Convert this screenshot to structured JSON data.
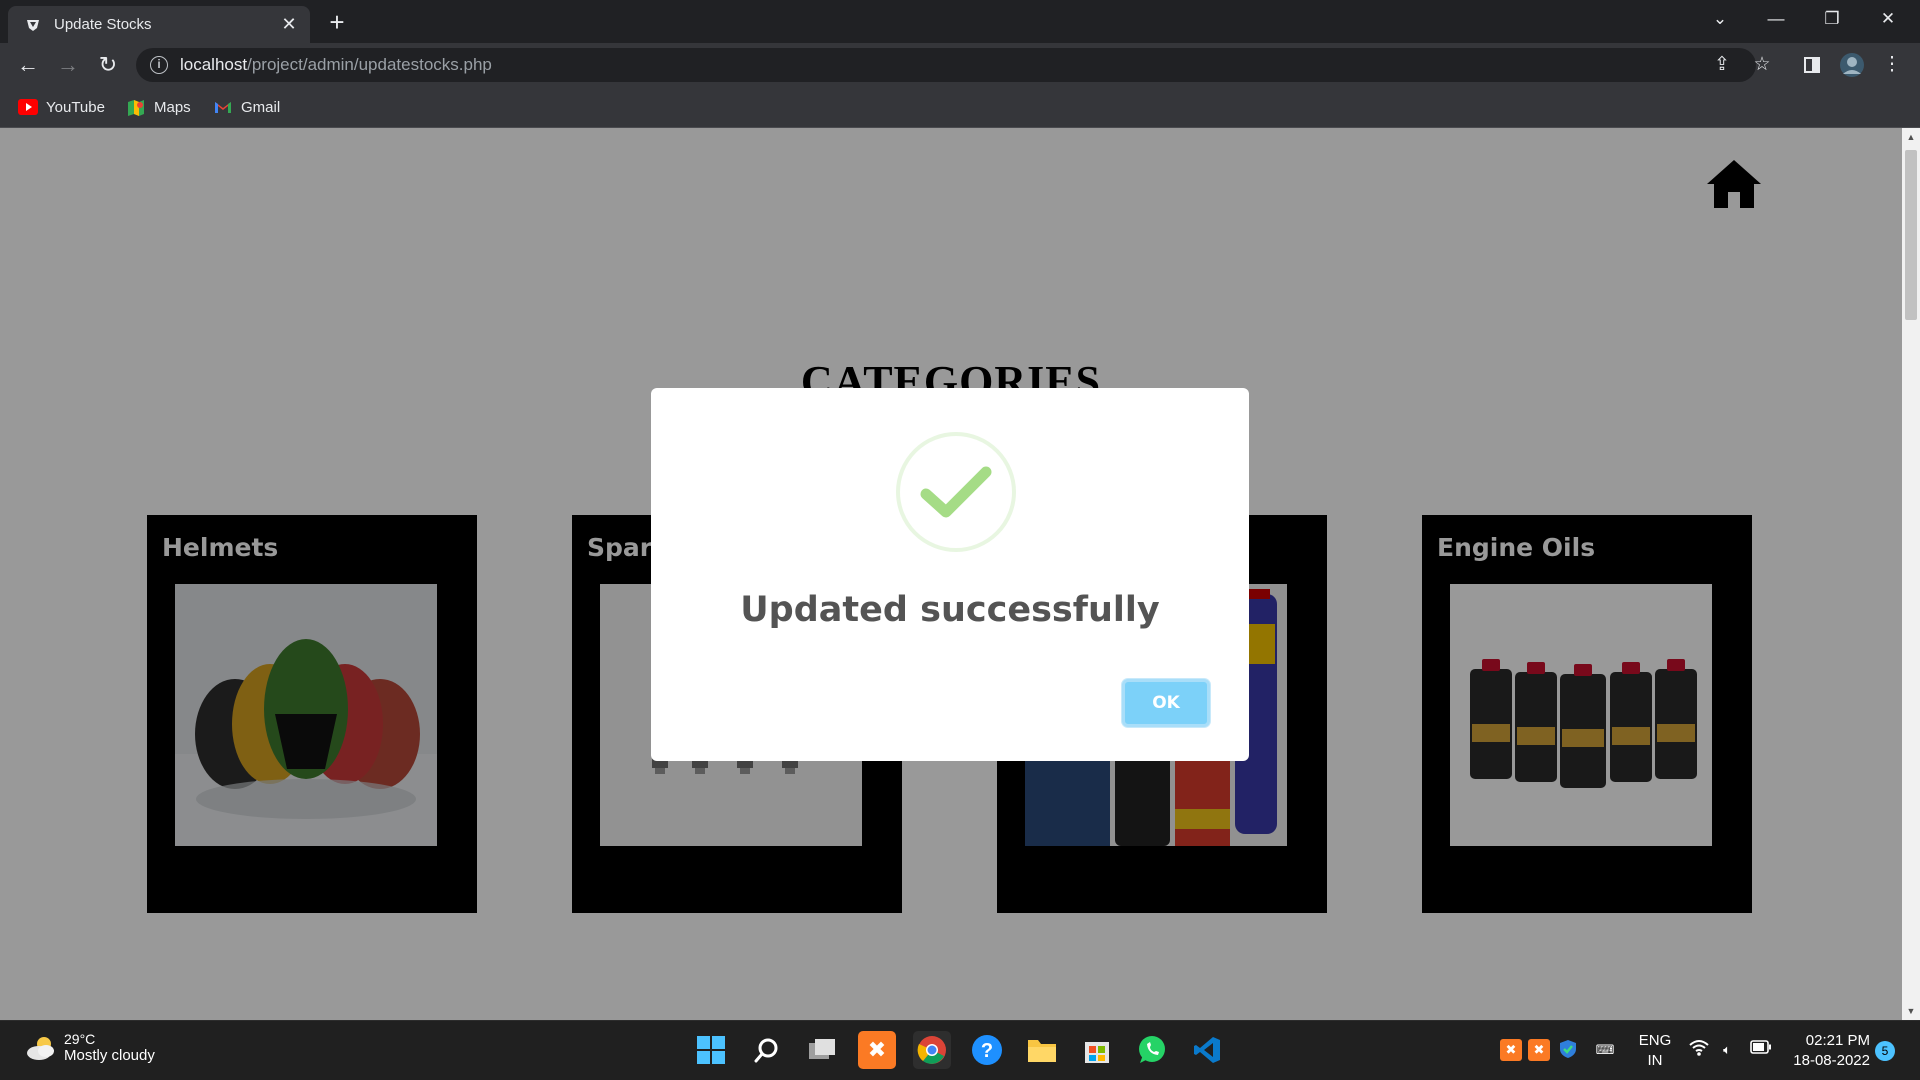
{
  "browser": {
    "tab_title": "Update Stocks",
    "tab_close": "✕",
    "new_tab": "+",
    "url_host": "localhost",
    "url_path": "/project/admin/updatestocks.php",
    "bookmarks": [
      {
        "label": "YouTube",
        "icon": "youtube-icon",
        "color": "#ff0000"
      },
      {
        "label": "Maps",
        "icon": "maps-icon",
        "color": "#34a853"
      },
      {
        "label": "Gmail",
        "icon": "gmail-icon",
        "color": "#ea4335"
      }
    ]
  },
  "page": {
    "heading": "CATEGORIES",
    "categories": [
      {
        "name": "Helmets"
      },
      {
        "name": "Spark"
      },
      {
        "name": ""
      },
      {
        "name": "Engine Oils"
      }
    ]
  },
  "dialog": {
    "message": "Updated successfully",
    "ok_label": "OK",
    "icon": "success-check-icon",
    "accent": "#a5dc86"
  },
  "taskbar": {
    "weather_temp": "29°C",
    "weather_desc": "Mostly cloudy",
    "lang_top": "ENG",
    "lang_bottom": "IN",
    "time": "02:21 PM",
    "date": "18-08-2022",
    "notifications": "5"
  }
}
